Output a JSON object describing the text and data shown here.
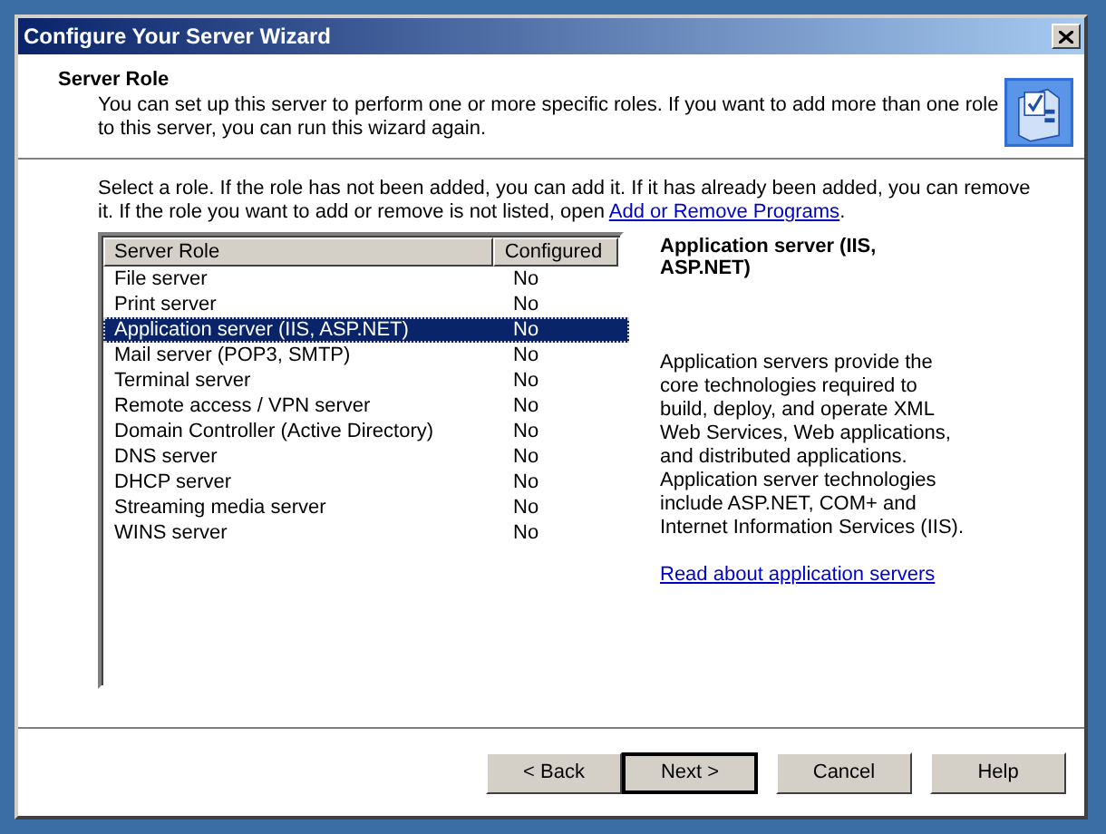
{
  "window": {
    "title": "Configure Your Server Wizard"
  },
  "header": {
    "title": "Server Role",
    "description": "You can set up this server to perform one or more specific roles. If you want to add more than one role to this server, you can run this wizard again."
  },
  "instructions": {
    "text": "Select a role. If the role has not been added, you can add it. If it has already been added, you can remove it. If the role you want to add or remove is not listed, open",
    "link": "Add or Remove Programs",
    "end": "."
  },
  "table": {
    "columns": [
      "Server Role",
      "Configured"
    ],
    "rows": [
      {
        "role": "File server",
        "configured": "No",
        "selected": false
      },
      {
        "role": "Print server",
        "configured": "No",
        "selected": false
      },
      {
        "role": "Application server (IIS, ASP.NET)",
        "configured": "No",
        "selected": true
      },
      {
        "role": "Mail server (POP3, SMTP)",
        "configured": "No",
        "selected": false
      },
      {
        "role": "Terminal server",
        "configured": "No",
        "selected": false
      },
      {
        "role": "Remote access / VPN server",
        "configured": "No",
        "selected": false
      },
      {
        "role": "Domain Controller (Active Directory)",
        "configured": "No",
        "selected": false
      },
      {
        "role": "DNS server",
        "configured": "No",
        "selected": false
      },
      {
        "role": "DHCP server",
        "configured": "No",
        "selected": false
      },
      {
        "role": "Streaming media server",
        "configured": "No",
        "selected": false
      },
      {
        "role": "WINS server",
        "configured": "No",
        "selected": false
      }
    ]
  },
  "details": {
    "title": "Application server (IIS, ASP.NET)",
    "description": "Application servers provide the core technologies required to build, deploy, and operate XML Web Services, Web applications, and distributed applications. Application server technologies include ASP.NET, COM+ and Internet Information Services (IIS).",
    "link": "Read about application servers"
  },
  "buttons": [
    {
      "label": "< Back",
      "default": false
    },
    {
      "label": "Next >",
      "default": true
    },
    {
      "label": "Cancel",
      "default": false
    },
    {
      "label": "Help",
      "default": false
    }
  ]
}
